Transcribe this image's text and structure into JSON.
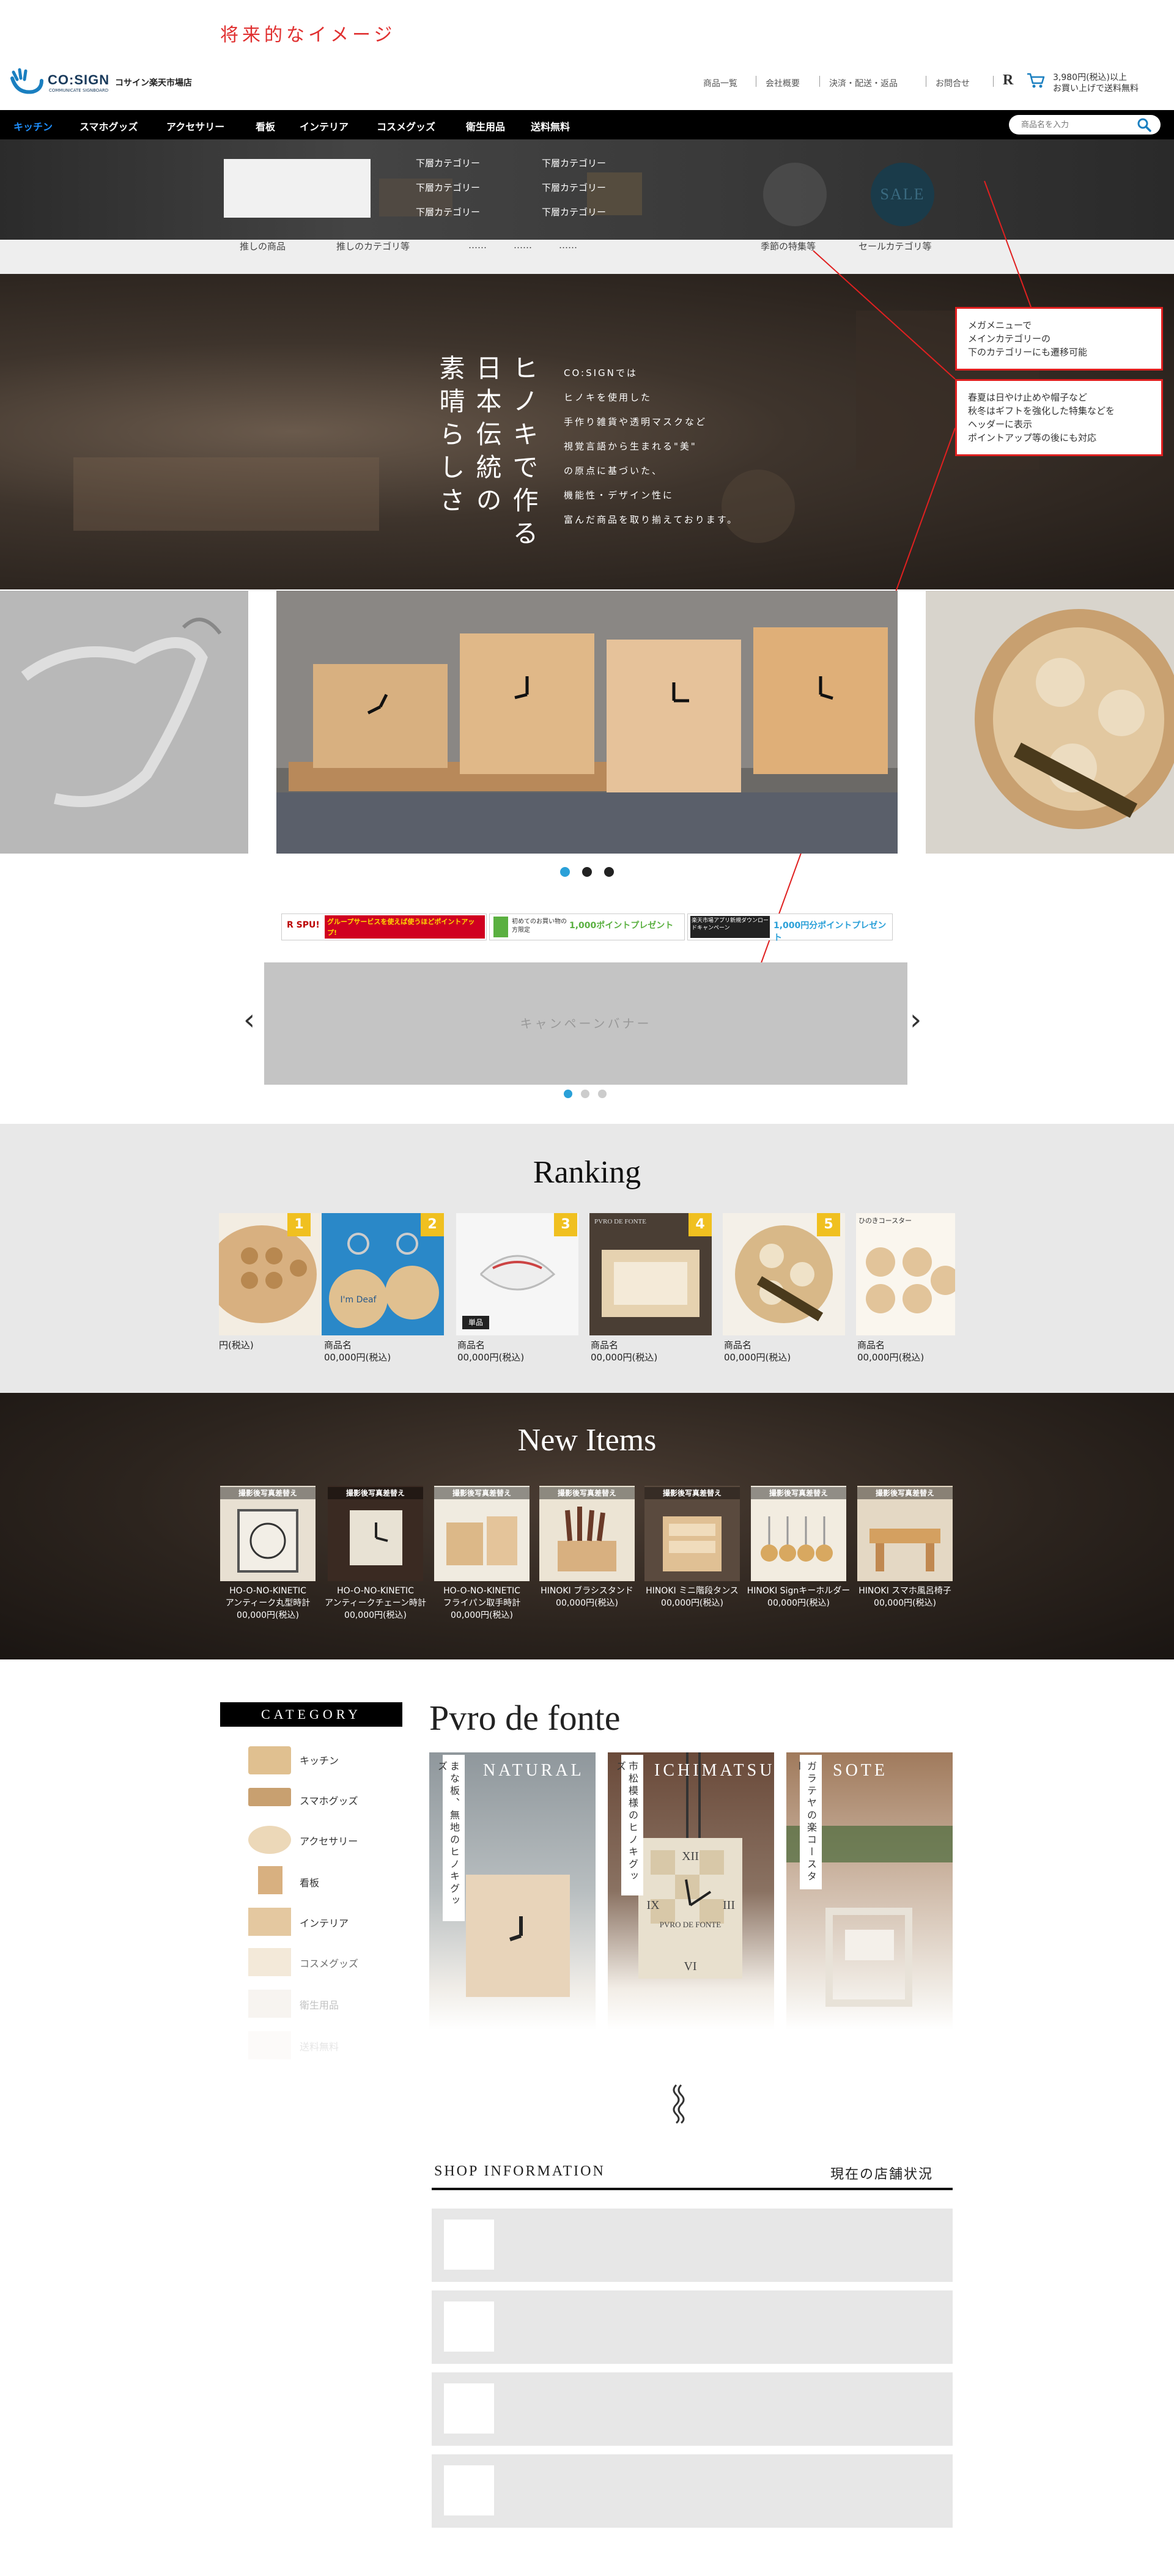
{
  "annotation_title": "将来的なイメージ",
  "header": {
    "logo_text": "CO:SIGN",
    "logo_sub": "COMMUNICATE SIGNBOARD",
    "shop_name": "コサイン楽天市場店",
    "nav": [
      "商品一覧",
      "会社概要",
      "決済・配送・返品",
      "お問合せ"
    ],
    "shipping_line1": "3,980円(税込)以上",
    "shipping_line2": "お買い上げで送料無料"
  },
  "navbar": {
    "items": [
      "キッチン",
      "スマホグッズ",
      "アクセサリー",
      "看板",
      "インテリア",
      "コスメグッズ",
      "衛生用品",
      "送料無料"
    ],
    "search_placeholder": "商品名を入力"
  },
  "mega_menu": {
    "links_col1": [
      "下層カテゴリー",
      "下層カテゴリー",
      "下層カテゴリー"
    ],
    "links_col2": [
      "下層カテゴリー",
      "下層カテゴリー",
      "下層カテゴリー"
    ],
    "sale_label": "SALE"
  },
  "subbar": {
    "links": [
      "推しの商品",
      "推しのカテゴリ等",
      "……",
      "……",
      "……",
      "季節の特集等",
      "セールカテゴリ等"
    ]
  },
  "hero": {
    "vertical_lines": [
      "ヒノキで作る",
      "日本伝統の",
      "素晴らしさ"
    ],
    "paragraph": [
      "CO:SIGNでは",
      "ヒノキを使用した",
      "手作り雑貨や透明マスクなど",
      "視覚言語から生まれる\"美\"",
      "の原点に基づいた、",
      "機能性・デザイン性に",
      "富んだ商品を取り揃えております。"
    ]
  },
  "notes": {
    "note1": [
      "メガメニューで",
      "メインカテゴリーの",
      "下のカテゴリーにも遷移可能"
    ],
    "note2": [
      "春夏は日やけ止めや帽子など",
      "秋冬はギフトを強化した特集などを",
      "ヘッダーに表示",
      "ポイントアップ等の後にも対応"
    ]
  },
  "banners": {
    "spu_label": "R SPU!",
    "spu_text": "グループサービスを使えば使うほどポイントアップ!",
    "first_text": "初めてのお買い物の方限定",
    "first_points": "1,000ポイントプレゼント",
    "app_text": "楽天市場アプリ新規ダウンロードキャンペーン",
    "app_points": "1,000円分ポイントプレゼント",
    "campaign_label": "キャンペーンバナー"
  },
  "ranking": {
    "title": "Ranking",
    "items": [
      {
        "rank": "1",
        "name": "",
        "price": "円(税込)"
      },
      {
        "rank": "2",
        "name": "商品名",
        "price": "00,000円(税込)"
      },
      {
        "rank": "3",
        "name": "商品名",
        "price": "00,000円(税込)"
      },
      {
        "rank": "4",
        "name": "商品名",
        "price": "00,000円(税込)"
      },
      {
        "rank": "5",
        "name": "商品名",
        "price": "00,000円(税込)"
      },
      {
        "rank": "",
        "name": "商品名",
        "price": "00,000円(税込)"
      }
    ],
    "tanpin": "単品",
    "coaster_label": "ひのきコースター",
    "pvro_mini": "PVRO DE FONTE",
    "fig_bubble": "I'm Deaf"
  },
  "new_items": {
    "title": "New Items",
    "label": "撮影後写真差替え",
    "items": [
      {
        "name1": "HO-O-NO-KINETIC",
        "name2": "アンティーク丸型時計",
        "price": "00,000円(税込)"
      },
      {
        "name1": "HO-O-NO-KINETIC",
        "name2": "アンティークチェーン時計",
        "price": "00,000円(税込)"
      },
      {
        "name1": "HO-O-NO-KINETIC",
        "name2": "フライパン取手時計",
        "price": "00,000円(税込)"
      },
      {
        "name1": "HINOKI ブラシスタンド",
        "name2": "",
        "price": "00,000円(税込)"
      },
      {
        "name1": "HINOKI ミニ階段タンス",
        "name2": "",
        "price": "00,000円(税込)"
      },
      {
        "name1": "HINOKI Signキーホルダー",
        "name2": "",
        "price": "00,000円(税込)"
      },
      {
        "name1": "HINOKI スマホ風呂椅子",
        "name2": "",
        "price": "00,000円(税込)"
      }
    ]
  },
  "category": {
    "title": "CATEGORY",
    "items": [
      "キッチン",
      "スマホグッズ",
      "アクセサリー",
      "看板",
      "インテリア",
      "コスメグッズ",
      "衛生用品",
      "送料無料"
    ]
  },
  "pvro": {
    "title": "Pvro de fonte",
    "cards": [
      {
        "title": "NATURAL",
        "vtext": "まな板、無地のヒノキグッズ"
      },
      {
        "title": "ICHIMATSU",
        "vtext": "市松模様のヒノキグッズ"
      },
      {
        "title": "SOTE",
        "vtext": "ガラテヤの楽コースター"
      }
    ],
    "clock_brand": "PVRO DE FONTE",
    "clock_xii": "XII",
    "clock_ix": "IX",
    "clock_iii": "III",
    "clock_vi": "VI"
  },
  "shop": {
    "title": "SHOP INFORMATION",
    "status": "現在の店舗状況"
  },
  "colors": {
    "accent": "#2aa0d8",
    "note_red": "#e02020",
    "badge": "#f0c020"
  }
}
